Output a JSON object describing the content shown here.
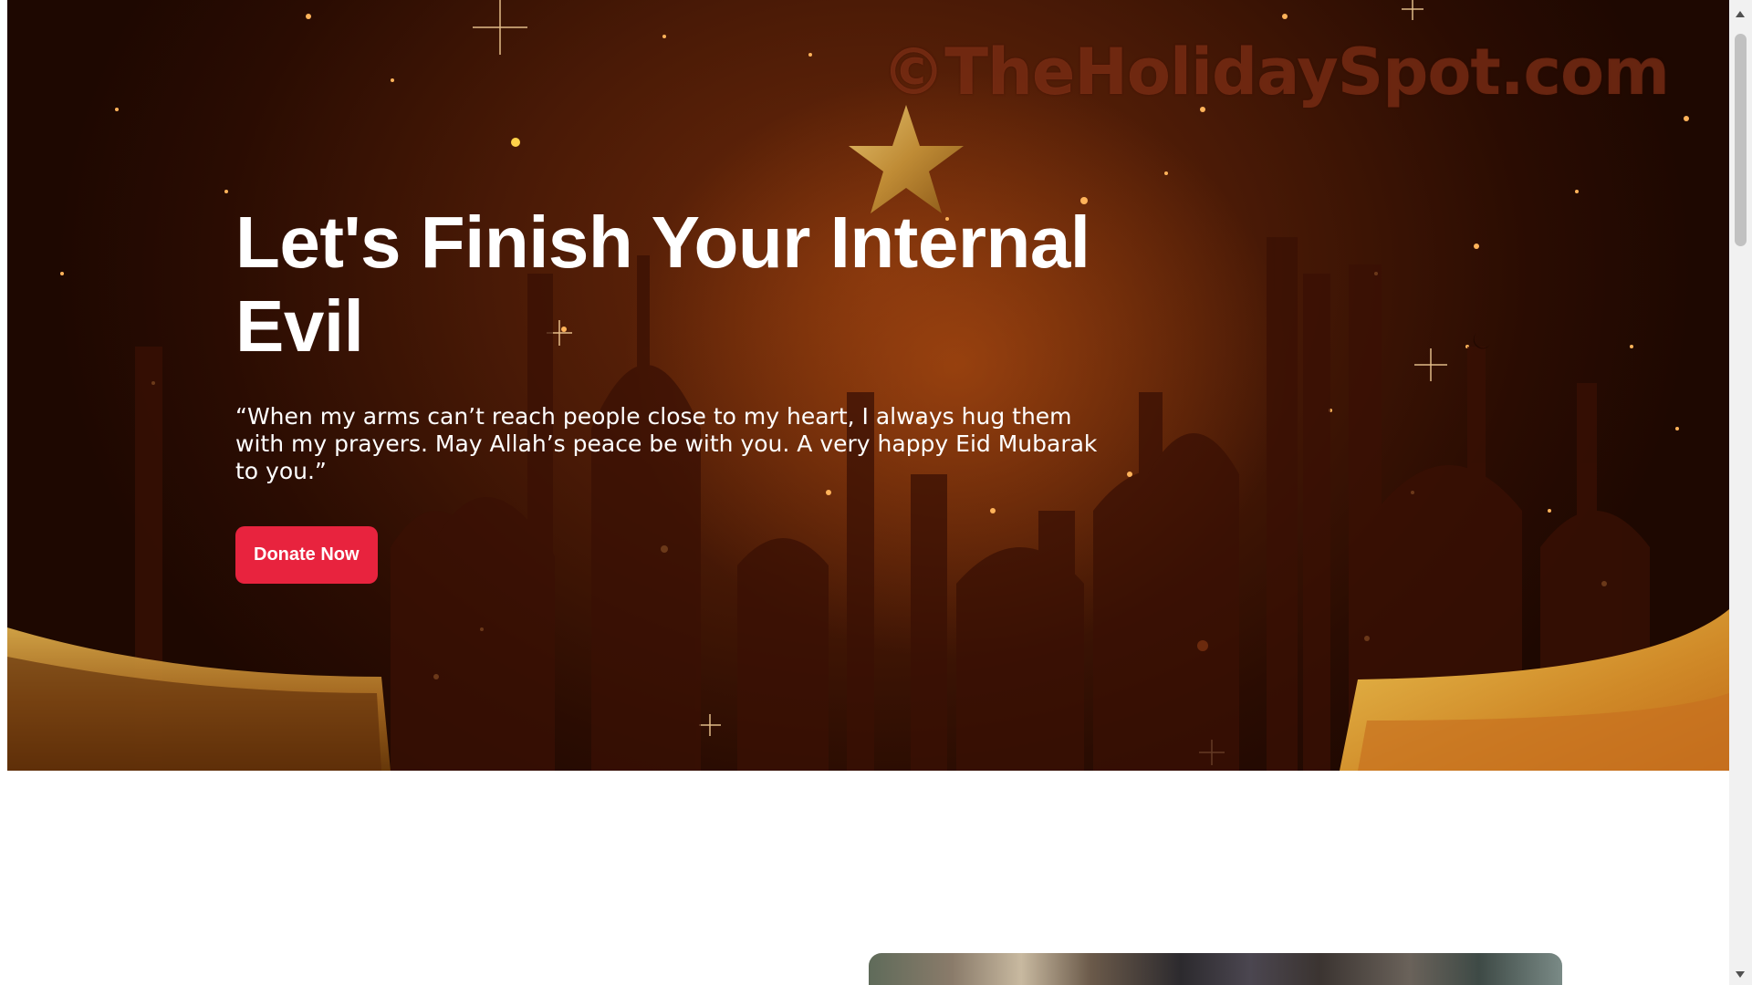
{
  "hero": {
    "watermark": "©TheHolidaySpot.com",
    "title": "Let's Finish Your Internal Evil",
    "quote": "“When my arms can’t reach people close to my heart, I always hug them with my prayers. May Allah’s peace be with you. A very happy Eid Mubarak to you.”",
    "donate_label": "Donate Now"
  },
  "colors": {
    "accent": "#e8233e",
    "hero_dark": "#2a0c02",
    "gold": "#d4a84a"
  }
}
